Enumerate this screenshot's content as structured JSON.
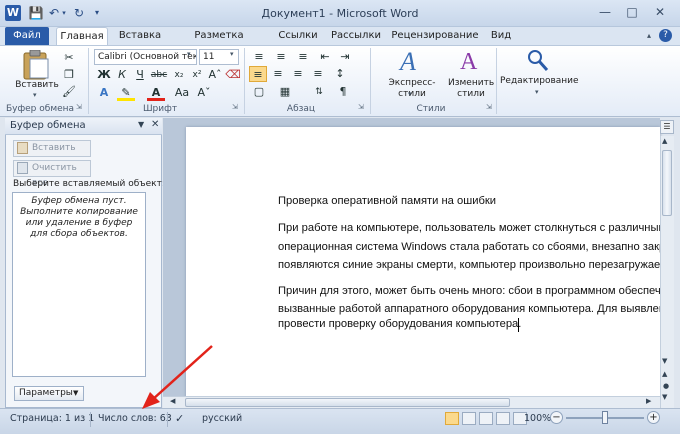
{
  "window": {
    "title": "Документ1 - Microsoft Word",
    "app_icon": "W",
    "controls": [
      "minimize-icon",
      "maximize-icon",
      "close-icon"
    ]
  },
  "tabs": [
    {
      "label": "Файл"
    },
    {
      "label": "Главная"
    },
    {
      "label": "Вставка"
    },
    {
      "label": "Разметка страницы"
    },
    {
      "label": "Ссылки"
    },
    {
      "label": "Рассылки"
    },
    {
      "label": "Рецензирование"
    },
    {
      "label": "Вид"
    }
  ],
  "ribbon": {
    "clipboard": {
      "label": "Буфер обмена",
      "paste_label": "Вставить"
    },
    "font": {
      "label": "Шрифт",
      "font_name": "Calibri (Основной тек",
      "font_size": "11"
    },
    "paragraph": {
      "label": "Абзац"
    },
    "styles": {
      "label": "Стили",
      "express_label": "Экспресс-стили",
      "change_label": "Изменить стили"
    },
    "editing": {
      "label": "Редактирование"
    }
  },
  "pane": {
    "title": "Буфер обмена",
    "paste_all": "Вставить все",
    "clear_all": "Очистить все",
    "select_prompt": "Выберите вставляемый объект:",
    "empty_info": "Буфер обмена пуст. Выполните копирование или удаление в буфер для сбора объектов.",
    "params_button": "Параметры"
  },
  "document": {
    "lines": [
      "Проверка оперативной памяти на ошибки",
      "При работе на компьютере, пользователь может столкнуться с различными",
      "операционная система Windows стала работать со сбоями, внезапно закры",
      "появляются синие экраны смерти, компьютер произвольно перезагружает",
      "Причин для этого, может быть очень много: сбои в программном обеспече",
      "вызванные работой аппаратного оборудования компьютера. Для выявлени",
      "провести проверку оборудования компьютера."
    ]
  },
  "status": {
    "page": "Страница: 1 из 1",
    "words": "Число слов: 63",
    "language": "русский",
    "zoom": "100%"
  },
  "colors": {
    "accent": "#2a5ba8",
    "arrow": "#e2231a",
    "selected": "#fbd98c"
  }
}
